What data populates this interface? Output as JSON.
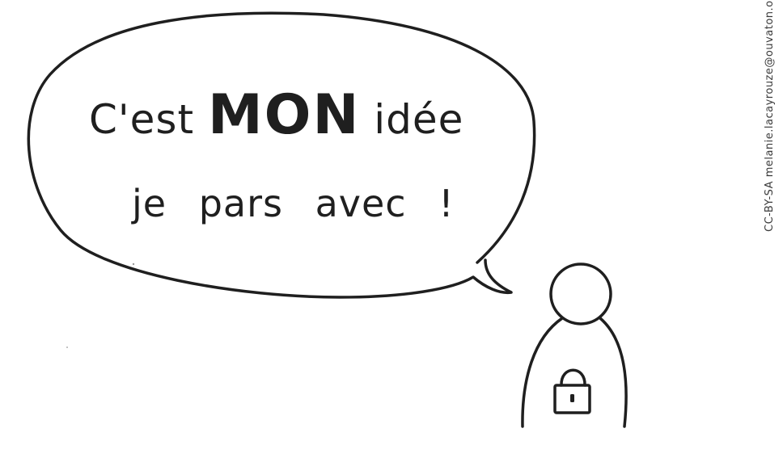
{
  "speech": {
    "line1_part1": "C'est ",
    "line1_emphasis": "MON",
    "line1_part2": " idée",
    "line2": "je pars avec !"
  },
  "credit": "CC-BY-SA melanie.lacayrouze@ouvaton.org",
  "icons": {
    "person": "person-icon",
    "lock": "padlock-icon"
  },
  "colors": {
    "ink": "#1f1f1f",
    "background": "#ffffff"
  }
}
